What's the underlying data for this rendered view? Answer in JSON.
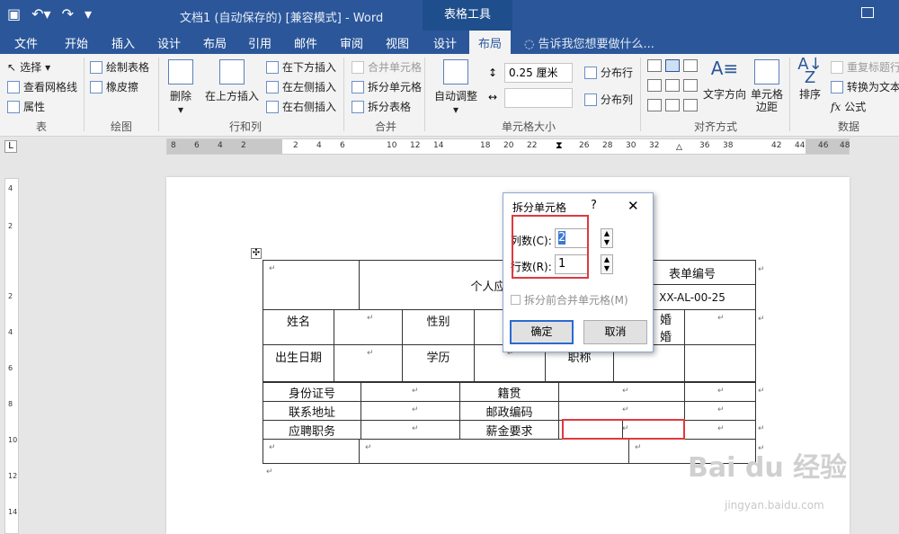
{
  "titlebar": {
    "save_icon": "save-icon",
    "undo_icon": "undo-icon",
    "redo_icon": "redo-icon",
    "customize_icon": "customize-qat-icon",
    "doc_title": "文档1 (自动保存的) [兼容模式] - Word",
    "context_tool": "表格工具"
  },
  "tabs": {
    "items": [
      "文件",
      "开始",
      "插入",
      "设计",
      "布局",
      "引用",
      "邮件",
      "审阅",
      "视图",
      "设计",
      "布局"
    ],
    "active": "布局",
    "search": "告诉我您想要做什么..."
  },
  "ribbon": {
    "table_group": {
      "select": "选择",
      "gridlines": "查看网格线",
      "properties": "属性",
      "label": "表"
    },
    "draw_group": {
      "draw_table": "绘制表格",
      "eraser": "橡皮擦",
      "label": "绘图"
    },
    "rows_cols_group": {
      "delete": "删除",
      "insert_above": "在上方插入",
      "insert_below": "在下方插入",
      "insert_left": "在左侧插入",
      "insert_right": "在右侧插入",
      "label": "行和列"
    },
    "merge_group": {
      "merge_cells": "合并单元格",
      "split_cells": "拆分单元格",
      "split_table": "拆分表格",
      "label": "合并"
    },
    "cell_size_group": {
      "autofit": "自动调整",
      "height": "0.25 厘米",
      "distribute_rows": "分布行",
      "distribute_cols": "分布列",
      "label": "单元格大小"
    },
    "align_group": {
      "text_direction": "文字方向",
      "cell_margins_1": "单元格",
      "cell_margins_2": "边距",
      "label": "对齐方式"
    },
    "data_group": {
      "sort": "排序",
      "repeat_header": "重复标题行",
      "convert": "转换为文本",
      "formula": "公式",
      "label": "数据"
    }
  },
  "ruler": {
    "corner": "L",
    "h_numbers": [
      "8",
      "6",
      "4",
      "2",
      "2",
      "4",
      "6",
      "10",
      "12",
      "14",
      "18",
      "20",
      "22",
      "26",
      "28",
      "30",
      "32",
      "36",
      "38",
      "42",
      "44",
      "46",
      "48"
    ],
    "v_numbers": [
      "4",
      "2",
      "2",
      "4",
      "6",
      "8",
      "10",
      "12",
      "14"
    ]
  },
  "table": {
    "row1": {
      "left": "",
      "middle": "个人应聘",
      "form_no_label": "表单编号",
      "form_no_value": "XX-AL-00-25"
    },
    "row3": {
      "name": "姓名",
      "gender": "性别",
      "marital_top": "婚",
      "marital_bottom": "婚"
    },
    "row4": {
      "birth": "出生日期",
      "education": "学历",
      "title": "职称"
    },
    "row5": {
      "id_no": "身份证号",
      "native": "籍贯"
    },
    "row6": {
      "address": "联系地址",
      "postcode": "邮政编码"
    },
    "row7": {
      "position": "应聘职务",
      "salary": "薪金要求"
    },
    "cell_mark": "↵"
  },
  "dialog": {
    "title": "拆分单元格",
    "help": "?",
    "close": "✕",
    "columns_label": "列数(C):",
    "columns_value": "2",
    "rows_label": "行数(R):",
    "rows_value": "1",
    "merge_before_label": "拆分前合并单元格(M)",
    "ok": "确定",
    "cancel": "取消"
  },
  "watermark": {
    "main": "Bai du 经验",
    "sub": "jingyan.baidu.com"
  },
  "colors": {
    "accent": "#2b579a",
    "highlight": "#e0383e"
  }
}
